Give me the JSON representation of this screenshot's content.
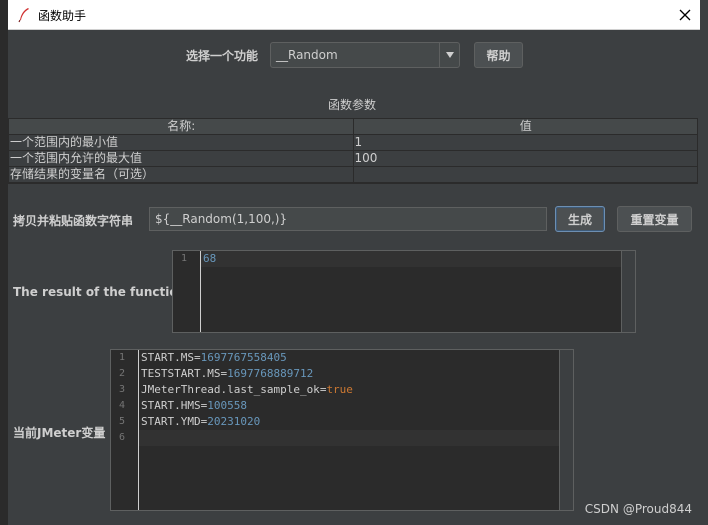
{
  "window": {
    "title": "函数助手",
    "close_label": "✕"
  },
  "function_select": {
    "label": "选择一个功能",
    "selected": "__Random",
    "help_label": "帮助"
  },
  "params": {
    "heading": "函数参数",
    "columns": [
      "名称:",
      "值"
    ],
    "rows": [
      {
        "name": "一个范围内的最小值",
        "value": "1"
      },
      {
        "name": "一个范围内允许的最大值",
        "value": "100"
      },
      {
        "name": "存储结果的变量名（可选）",
        "value": ""
      }
    ]
  },
  "copy_paste": {
    "label": "拷贝并粘贴函数字符串",
    "value": "${__Random(1,100,)}",
    "generate_label": "生成",
    "reset_label": "重置变量"
  },
  "result": {
    "label": "The result of the function is",
    "lines": [
      "68"
    ],
    "line_numbers": [
      "1"
    ]
  },
  "variables": {
    "label": "当前JMeter变量",
    "line_numbers": [
      "1",
      "2",
      "3",
      "4",
      "5",
      "6"
    ],
    "lines": [
      {
        "key": "START.MS",
        "eq": "=",
        "val": "1697767558405",
        "type": "num"
      },
      {
        "key": "TESTSTART.MS",
        "eq": "=",
        "val": "1697768889712",
        "type": "num"
      },
      {
        "key": "JMeterThread.last_sample_ok",
        "eq": "=",
        "val": "true",
        "type": "kw"
      },
      {
        "key": "START.HMS",
        "eq": "=",
        "val": "100558",
        "type": "num"
      },
      {
        "key": "START.YMD",
        "eq": "=",
        "val": "20231020",
        "type": "num"
      },
      {
        "key": "",
        "eq": "",
        "val": "",
        "type": "num"
      }
    ]
  },
  "watermark": "CSDN @Proud844",
  "colors": {
    "background": "#3c3f41",
    "editor": "#2b2b2b",
    "number": "#6897bb",
    "keyword": "#cc7832"
  }
}
